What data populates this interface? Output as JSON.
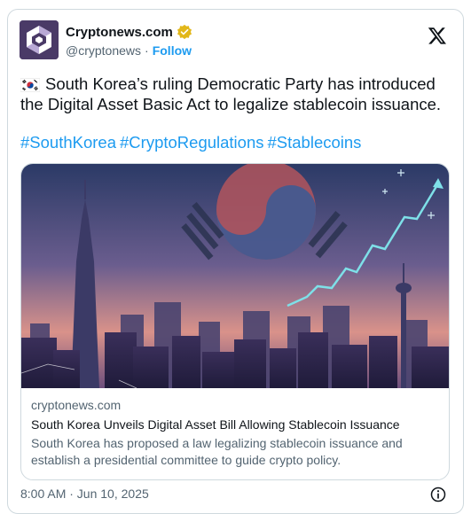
{
  "author": {
    "display_name": "Cryptonews.com",
    "handle": "@cryptonews",
    "separator": "·",
    "follow_label": "Follow"
  },
  "tweet": {
    "flag_icon": "south-korea-flag-icon",
    "text": "South Korea’s ruling Democratic Party has introduced the Digital Asset Basic Act to legalize stablecoin issuance.",
    "hashtags": [
      "#SouthKorea",
      "#CryptoRegulations",
      "#Stablecoins"
    ]
  },
  "link_card": {
    "domain": "cryptonews.com",
    "title": "South Korea Unveils Digital Asset Bill Allowing Stablecoin Issuance",
    "description": "South Korea has proposed a law legalizing stablecoin issuance and establish a presidential committee to guide crypto policy."
  },
  "footer": {
    "timestamp": "8:00 AM · Jun 10, 2025",
    "info_icon": "info-icon"
  },
  "colors": {
    "link_blue": "#1d9bf0",
    "text_primary": "#0f1419",
    "text_secondary": "#536471",
    "verified_gold": "#e2b719"
  }
}
